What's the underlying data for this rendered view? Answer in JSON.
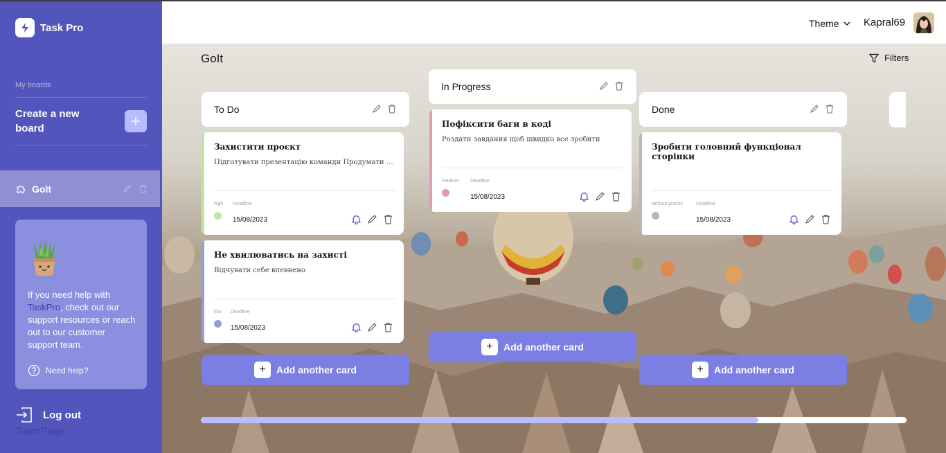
{
  "app": {
    "name": "Task Pro"
  },
  "sidebar": {
    "my_boards_label": "My boards",
    "create_board_label": "Create a new board",
    "boards": [
      {
        "name": "GoIt"
      }
    ],
    "help": {
      "text_before": "If you need help with ",
      "link_text": "TaskPro",
      "text_after": ", check out our support resources or reach out to our customer support team.",
      "need_help_label": "Need help?"
    },
    "logout_label": "Log out",
    "footer_label": "TeamPage"
  },
  "header": {
    "theme_label": "Theme",
    "username": "Kapral69"
  },
  "board": {
    "title": "GoIt",
    "filters_label": "Filters",
    "add_card_label": "Add another card",
    "deadline_label": "Deadline",
    "scroll_position": 0.79,
    "columns": [
      {
        "title": "To Do",
        "cards": [
          {
            "title": "Захистити проєкт",
            "description": "Підготувати презентацію команди Продумати промову для захисту",
            "priority": "high",
            "priority_color": "#bce6a6",
            "deadline": "15/08/2023"
          },
          {
            "title": "Не хвилюватись на захисті",
            "description": "Відчувати себе впевнено",
            "priority": "low",
            "priority_color": "#8fa1d0",
            "deadline": "15/08/2023"
          }
        ]
      },
      {
        "title": "In Progress",
        "cards": [
          {
            "title": "Пофіксити баги в коді",
            "description": "Роздати завдання щоб швидко все зробити",
            "priority": "medium",
            "priority_color": "#e09cb5",
            "deadline": "15/08/2023"
          }
        ]
      },
      {
        "title": "Done",
        "cards": [
          {
            "title": "Зробити головний функціонал сторінки",
            "description": "",
            "priority": "without priority",
            "priority_color": "#b6b6b6",
            "deadline": "15/08/2023"
          }
        ]
      }
    ]
  },
  "colors": {
    "sidebar": "#5255bc",
    "accent": "#7b7fe3",
    "accent_light": "#b8bcfd"
  },
  "icons": [
    "lightning-icon",
    "plus-icon",
    "puzzle-icon",
    "pencil-icon",
    "trash-icon",
    "help-icon",
    "logout-icon",
    "chevron-down-icon",
    "filter-icon",
    "bell-icon"
  ]
}
